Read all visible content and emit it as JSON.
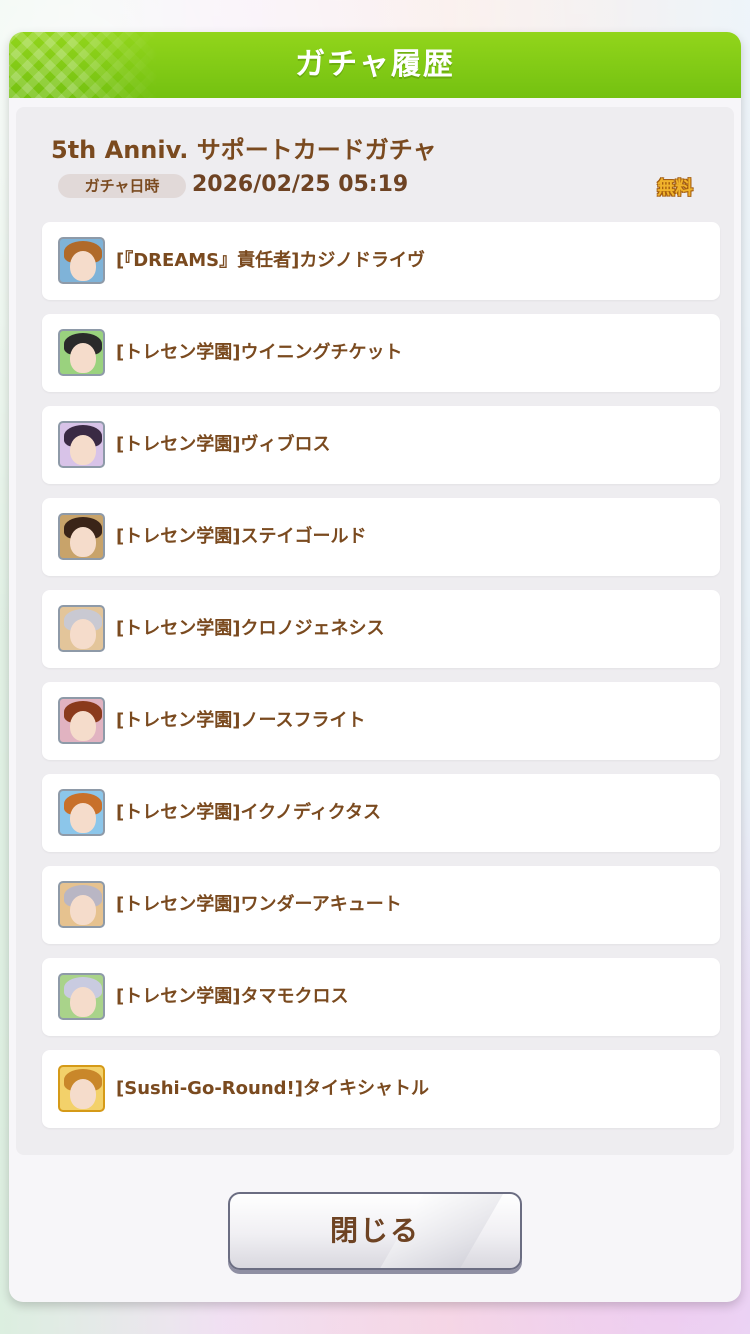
{
  "dialog": {
    "title": "ガチャ履歴",
    "gacha_name": "5th Anniv. サポートカードガチャ",
    "date_label": "ガチャ日時",
    "date_value": "2026/02/25 05:19",
    "cost_label": "無料",
    "close_label": "閉じる"
  },
  "cards": [
    {
      "name": "[『DREAMS』責任者]カジノドライヴ",
      "frame": "silver",
      "bg": "#7fb3d8",
      "hair": "#b06a2a"
    },
    {
      "name": "[トレセン学園]ウイニングチケット",
      "frame": "silver",
      "bg": "#9ad27e",
      "hair": "#2a2a2a"
    },
    {
      "name": "[トレセン学園]ヴィブロス",
      "frame": "silver",
      "bg": "#d8c3e8",
      "hair": "#3a2a44"
    },
    {
      "name": "[トレセン学園]ステイゴールド",
      "frame": "silver",
      "bg": "#c8a36a",
      "hair": "#3a2418"
    },
    {
      "name": "[トレセン学園]クロノジェネシス",
      "frame": "silver",
      "bg": "#e3c59a",
      "hair": "#c9c9d2"
    },
    {
      "name": "[トレセン学園]ノースフライト",
      "frame": "silver",
      "bg": "#e1b3c1",
      "hair": "#8a3a1c"
    },
    {
      "name": "[トレセン学園]イクノディクタス",
      "frame": "silver",
      "bg": "#8cc6ea",
      "hair": "#c8702a"
    },
    {
      "name": "[トレセン学園]ワンダーアキュート",
      "frame": "silver",
      "bg": "#e6c28f",
      "hair": "#b9b6c4"
    },
    {
      "name": "[トレセン学園]タマモクロス",
      "frame": "silver",
      "bg": "#a9d38a",
      "hair": "#c9cbe0"
    },
    {
      "name": "[Sushi-Go-Round!]タイキシャトル",
      "frame": "gold",
      "bg": "#f3d16a",
      "hair": "#c9872a"
    }
  ]
}
